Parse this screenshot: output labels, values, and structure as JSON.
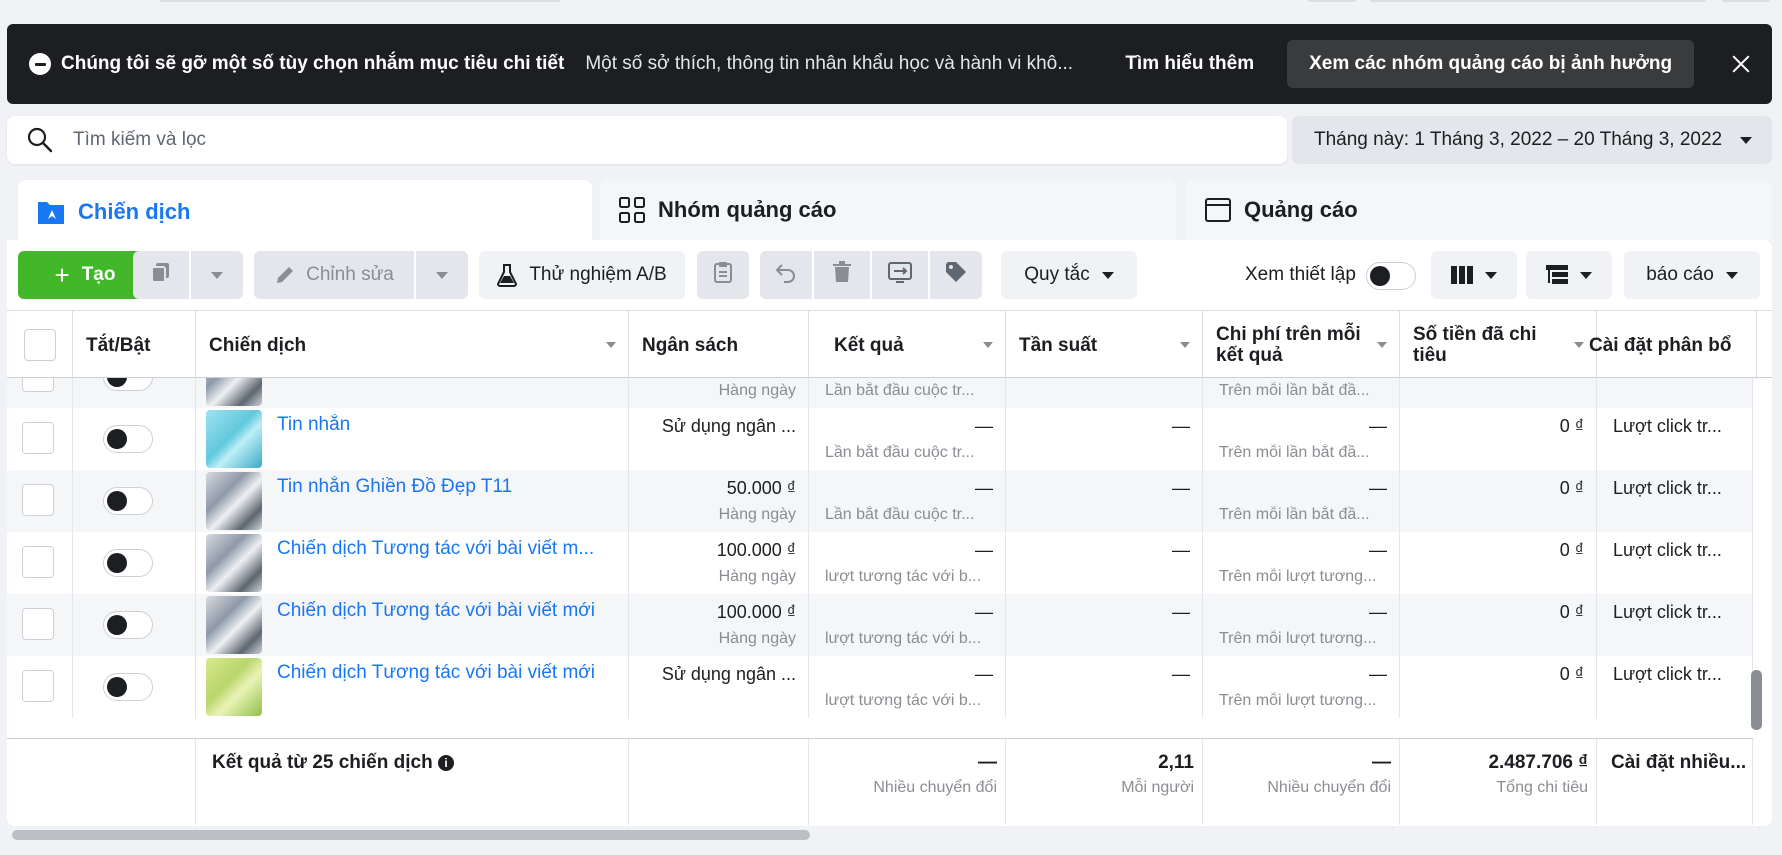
{
  "banner": {
    "title": "Chúng tôi sẽ gỡ một số tùy chọn nhắm mục tiêu chi tiết",
    "text": "Một số sở thích, thông tin nhân khẩu học và hành vi khô...",
    "learn_more": "Tìm hiểu thêm",
    "view_affected": "Xem các nhóm quảng cáo bị ảnh hưởng"
  },
  "search": {
    "placeholder": "Tìm kiếm và lọc"
  },
  "date_range": {
    "label": "Tháng này: 1 Tháng 3, 2022 – 20 Tháng 3, 2022"
  },
  "tabs": [
    {
      "label": "Chiến dịch",
      "active": true
    },
    {
      "label": "Nhóm quảng cáo"
    },
    {
      "label": "Quảng cáo"
    }
  ],
  "toolbar": {
    "create": "Tạo",
    "edit": "Chỉnh sửa",
    "ab_test": "Thử nghiệm A/B",
    "rules": "Quy tắc",
    "view_setup": "Xem thiết lập",
    "report": "báo cáo"
  },
  "columns": {
    "toggle": "Tắt/Bật",
    "campaign": "Chiến dịch",
    "budget": "Ngân sách",
    "results": "Kết quả",
    "frequency": "Tần suất",
    "cost_per_result": "Chi phí trên mỗi kết quả",
    "amount_spent": "Số tiền đã chi tiêu",
    "attribution": "Cài đặt phân bổ"
  },
  "rows": [
    {
      "name": "",
      "budget": "",
      "budget_sub": "Hàng ngày",
      "result": "",
      "result_sub": "Lần bắt đầu cuộc tr...",
      "frequency": "",
      "cpr": "",
      "cpr_sub": "Trên mỗi lần bắt đầ...",
      "spent": "",
      "attribution": "",
      "thumb": "gray"
    },
    {
      "name": "Tin nhắn",
      "budget": "Sử dụng ngân ...",
      "budget_sub": "",
      "result": "—",
      "result_sub": "Lần bắt đầu cuộc tr...",
      "frequency": "—",
      "cpr": "—",
      "cpr_sub": "Trên mỗi lần bắt đầ...",
      "spent": "0 ₫",
      "attribution": "Lượt click tr...",
      "thumb": "blue"
    },
    {
      "name": "Tin nhắn Ghiền Đồ Đẹp T11",
      "budget": "50.000 ₫",
      "budget_sub": "Hàng ngày",
      "result": "—",
      "result_sub": "Lần bắt đầu cuộc tr...",
      "frequency": "—",
      "cpr": "—",
      "cpr_sub": "Trên mỗi lần bắt đầ...",
      "spent": "0 ₫",
      "attribution": "Lượt click tr...",
      "thumb": "gray"
    },
    {
      "name": "Chiến dịch Tương tác với bài viết m...",
      "budget": "100.000 ₫",
      "budget_sub": "Hàng ngày",
      "result": "—",
      "result_sub": "lượt tương tác với b...",
      "frequency": "—",
      "cpr": "—",
      "cpr_sub": "Trên mỗi lượt tương...",
      "spent": "0 ₫",
      "attribution": "Lượt click tr...",
      "thumb": "gray"
    },
    {
      "name": "Chiến dịch Tương tác với bài viết mới",
      "budget": "100.000 ₫",
      "budget_sub": "Hàng ngày",
      "result": "—",
      "result_sub": "lượt tương tác với b...",
      "frequency": "—",
      "cpr": "—",
      "cpr_sub": "Trên mỗi lượt tương...",
      "spent": "0 ₫",
      "attribution": "Lượt click tr...",
      "thumb": "gray"
    },
    {
      "name": "Chiến dịch Tương tác với bài viết mới",
      "budget": "Sử dụng ngân ...",
      "budget_sub": "",
      "result": "—",
      "result_sub": "lượt tương tác với b...",
      "frequency": "—",
      "cpr": "—",
      "cpr_sub": "Trên mỗi lượt tương...",
      "spent": "0 ₫",
      "attribution": "Lượt click tr...",
      "thumb": "green"
    }
  ],
  "footer": {
    "label": "Kết quả từ 25 chiến dịch",
    "results": "—",
    "results_sub": "Nhiều chuyển đổi",
    "frequency": "2,11",
    "frequency_sub": "Mỗi người",
    "cpr": "—",
    "cpr_sub": "Nhiều chuyển đổi",
    "spent": "2.487.706 ₫",
    "spent_sub": "Tổng chi tiêu",
    "attribution": "Cài đặt nhiều..."
  },
  "colors": {
    "accent": "#1877f2",
    "create_green": "#42b72a",
    "banner_bg": "#1c1e21"
  }
}
